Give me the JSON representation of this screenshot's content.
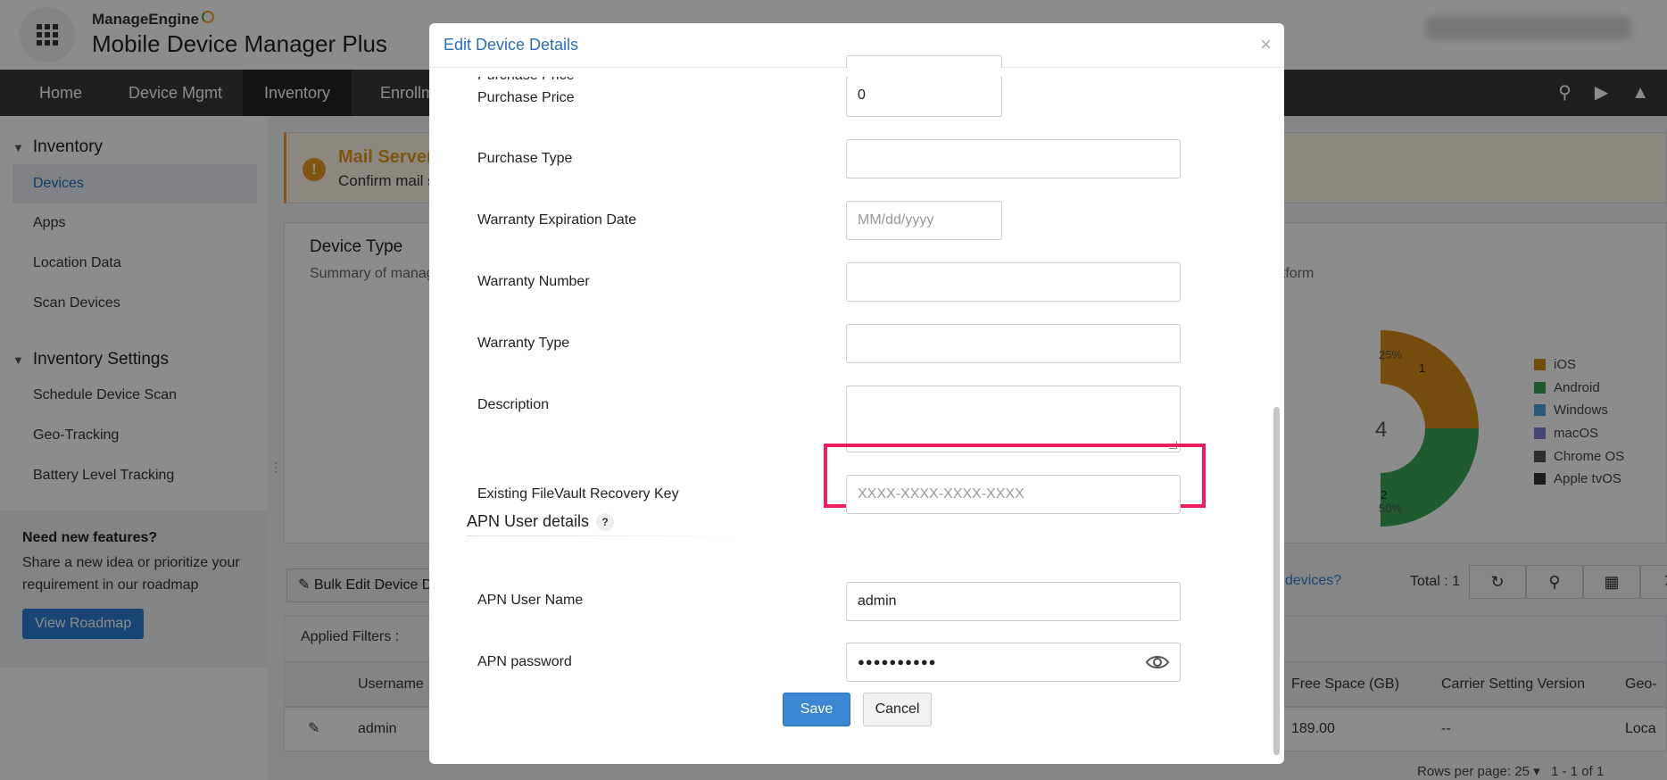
{
  "app": {
    "vendor": "ManageEngine",
    "product": "Mobile Device Manager Plus"
  },
  "navbar": {
    "items": [
      "Home",
      "Device Mgmt",
      "Inventory",
      "Enrollm"
    ],
    "active": "Inventory",
    "right_icons": [
      "search-icon",
      "video-icon",
      "rocket-icon"
    ]
  },
  "sidebar": {
    "section1": "Inventory",
    "items1": [
      "Devices",
      "Apps",
      "Location Data",
      "Scan Devices"
    ],
    "section2": "Inventory Settings",
    "items2": [
      "Schedule Device Scan",
      "Geo-Tracking",
      "Battery Level Tracking"
    ],
    "promo_title": "Need new features?",
    "promo_text": "Share a new idea or prioritize your requirement in our roadmap",
    "promo_button": "View Roadmap"
  },
  "main": {
    "alert_title": "Mail Server",
    "alert_text": "Confirm mail s",
    "card_title": "Device Type",
    "card_sub": "Summary of manag",
    "card_sub2": "atform",
    "donut_center": "4",
    "chart_data": {
      "type": "pie",
      "slices": [
        {
          "label": "iOS",
          "value": 1,
          "color": "#d48a14"
        },
        {
          "label": "Android",
          "value": 2,
          "color": "#3aa655"
        }
      ],
      "annotations": [
        "25%",
        "50%"
      ]
    },
    "legend": [
      {
        "label": "iOS",
        "color": "#d48a14"
      },
      {
        "label": "Android",
        "color": "#3aa655"
      },
      {
        "label": "Windows",
        "color": "#4aa3df"
      },
      {
        "label": "macOS",
        "color": "#7f7fd5"
      },
      {
        "label": "Chrome OS",
        "color": "#555555"
      },
      {
        "label": "Apple tvOS",
        "color": "#333333"
      }
    ],
    "bulk_edit": "Bulk Edit Device D",
    "devices_link": "devices?",
    "total": "Total : 1",
    "applied_filters": "Applied Filters  :",
    "columns": [
      "Username",
      "Free Space (GB)",
      "Carrier Setting Version",
      "Geo-"
    ],
    "row": {
      "username": "admin",
      "free_space": "189.00",
      "carrier": "--",
      "geo": "Loca"
    },
    "rows_per_page_label": "Rows per page:",
    "rows_per_page": "25",
    "pagination": "1 - 1 of 1"
  },
  "modal": {
    "title": "Edit Device Details",
    "close": "×",
    "fields": {
      "purchase_price_label": "Purchase Price",
      "purchase_price_value": "0",
      "purchase_type_label": "Purchase Type",
      "warranty_exp_label": "Warranty Expiration Date",
      "warranty_exp_placeholder": "MM/dd/yyyy",
      "warranty_number_label": "Warranty Number",
      "warranty_type_label": "Warranty Type",
      "description_label": "Description",
      "filevault_label": "Existing FileVault Recovery Key",
      "filevault_placeholder": "XXXX-XXXX-XXXX-XXXX"
    },
    "apn_section": "APN User details",
    "apn_help": "?",
    "apn_user_label": "APN User Name",
    "apn_user_value": "admin",
    "apn_pass_label": "APN password",
    "apn_pass_value": "●●●●●●●●●●",
    "save": "Save",
    "cancel": "Cancel"
  }
}
